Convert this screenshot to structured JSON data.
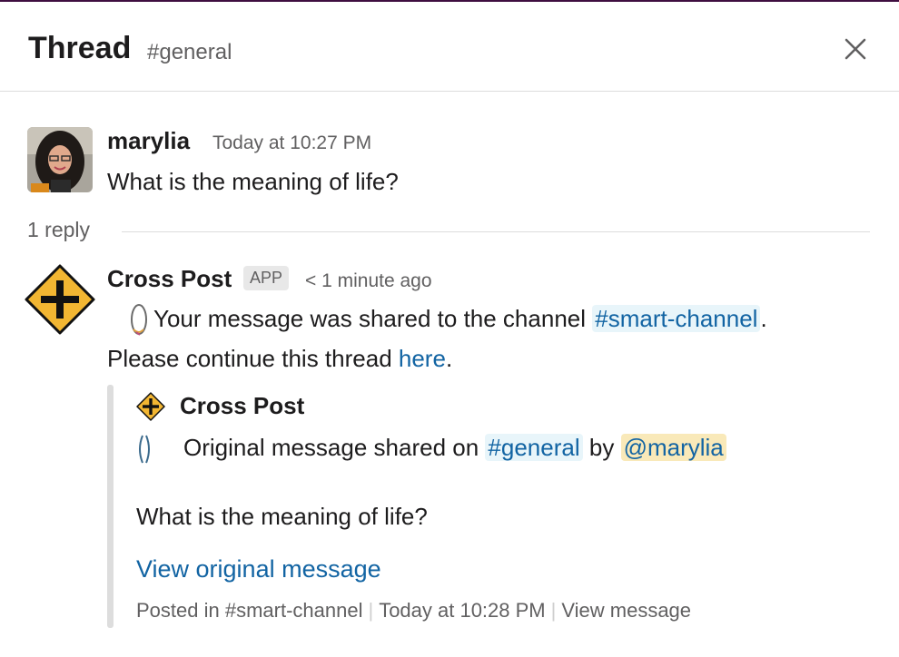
{
  "header": {
    "title": "Thread",
    "channel": "#general"
  },
  "parent_message": {
    "author": "marylia",
    "timestamp": "Today at 10:27 PM",
    "text": "What is the meaning of life?"
  },
  "replies": {
    "count_label": "1 reply"
  },
  "reply": {
    "author": "Cross Post",
    "badge": "APP",
    "timestamp": "< 1 minute ago",
    "line1_prefix": "Your message was shared to the channel",
    "line1_channel": "#smart-channel",
    "line1_suffix": ".",
    "line2_prefix": "Please continue this thread",
    "line2_link": "here",
    "line2_suffix": "."
  },
  "attachment": {
    "author": "Cross Post",
    "shared_prefix": "Original message shared on",
    "shared_channel": "#general",
    "shared_by": "by",
    "shared_user": "@marylia",
    "quote": "What is the meaning of life?",
    "view_link": "View original message",
    "footer_posted_in": "Posted in #smart-channel",
    "footer_time": "Today at 10:28 PM",
    "footer_view": "View message"
  },
  "colors": {
    "link": "#1264a3",
    "channel_pill_bg": "#e8f5fa",
    "user_pill_bg": "#f9e9b9",
    "sign_yellow": "#f2b632"
  }
}
